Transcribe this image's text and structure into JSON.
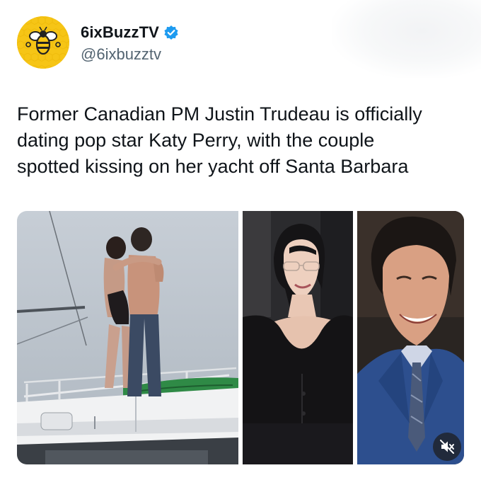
{
  "account": {
    "display_name": "6ixBuzzTV",
    "handle": "@6ixbuzztv",
    "verified": true,
    "avatar_icon": "bee-logo-icon",
    "brand_color": "#f6c516",
    "verified_color": "#1d9bf0"
  },
  "tweet": {
    "text_lines": [
      "Former Canadian PM Justin Trudeau is officially",
      "dating pop star Katy Perry, with the couple",
      "spotted kissing on her yacht off Santa Barbara"
    ]
  },
  "media": {
    "photos": [
      {
        "icon": "yacht-couple-photo"
      },
      {
        "icon": "woman-portrait-photo"
      },
      {
        "icon": "man-portrait-photo"
      }
    ],
    "mute_icon": "speaker-muted-icon"
  }
}
